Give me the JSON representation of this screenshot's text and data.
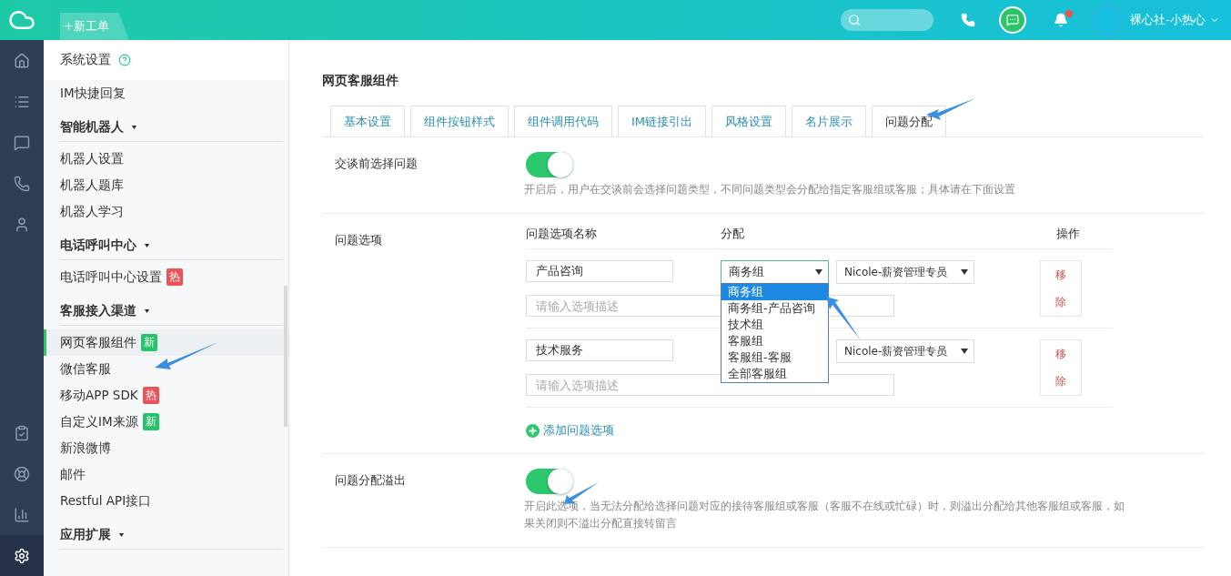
{
  "topbar": {
    "new_ticket": "+新工单",
    "user": "裸心社-小热心",
    "unread": true
  },
  "rail": [
    {
      "selected": false
    },
    {
      "selected": false
    },
    {
      "selected": false
    },
    {
      "selected": false
    },
    {
      "selected": false
    },
    {
      "selected": false
    },
    {
      "selected": false
    },
    {
      "selected": false
    },
    {
      "selected": true
    }
  ],
  "sidebar": {
    "header": "系统设置",
    "items": [
      {
        "kind": "item",
        "label": "IM快捷回复",
        "selected": false
      },
      {
        "kind": "group",
        "label": "智能机器人"
      },
      {
        "kind": "item",
        "label": "机器人设置",
        "selected": false
      },
      {
        "kind": "item",
        "label": "机器人题库",
        "selected": false
      },
      {
        "kind": "item",
        "label": "机器人学习",
        "selected": false
      },
      {
        "kind": "group",
        "label": "电话呼叫中心"
      },
      {
        "kind": "item",
        "label": "电话呼叫中心设置",
        "selected": false,
        "badge": {
          "text": "热",
          "color": "#e9545a"
        }
      },
      {
        "kind": "group",
        "label": "客服接入渠道"
      },
      {
        "kind": "item",
        "label": "网页客服组件",
        "selected": true,
        "badge": {
          "text": "新",
          "color": "#27c26c"
        }
      },
      {
        "kind": "item",
        "label": "微信客服",
        "selected": false
      },
      {
        "kind": "item",
        "label": "移动APP SDK",
        "selected": false,
        "badge": {
          "text": "热",
          "color": "#e9545a"
        }
      },
      {
        "kind": "item",
        "label": "自定义IM来源",
        "selected": false,
        "badge": {
          "text": "新",
          "color": "#27c26c"
        }
      },
      {
        "kind": "item",
        "label": "新浪微博",
        "selected": false
      },
      {
        "kind": "item",
        "label": "邮件",
        "selected": false
      },
      {
        "kind": "item",
        "label": "Restful API接口",
        "selected": false
      },
      {
        "kind": "group",
        "label": "应用扩展"
      }
    ]
  },
  "page_title": "网页客服组件",
  "tabs": [
    {
      "label": "基本设置",
      "selected": false
    },
    {
      "label": "组件按钮样式",
      "selected": false
    },
    {
      "label": "组件调用代码",
      "selected": false
    },
    {
      "label": "IM链接引出",
      "selected": false
    },
    {
      "label": "风格设置",
      "selected": false
    },
    {
      "label": "名片展示",
      "selected": false
    },
    {
      "label": "问题分配",
      "selected": true
    }
  ],
  "pre_chat": {
    "label": "交谈前选择问题",
    "on": true,
    "description": "开启后，用户在交谈前会选择问题类型，不同问题类型会分配给指定客服组或客服；具体请在下面设置"
  },
  "options": {
    "label": "问题选项",
    "columns": [
      "问题选项名称",
      "分配",
      "操作"
    ],
    "rows": [
      {
        "name": "产品咨询",
        "description_placeholder": "请输入选项描述",
        "group": {
          "value": "商务组",
          "open": true,
          "options": [
            {
              "label": "商务组",
              "selected": true
            },
            {
              "label": "商务组-产品咨询",
              "selected": false
            },
            {
              "label": "技术组",
              "selected": false
            },
            {
              "label": "客服组",
              "selected": false
            },
            {
              "label": "客服组-客服",
              "selected": false
            },
            {
              "label": "全部客服组",
              "selected": false
            }
          ]
        },
        "agent": "Nicole-薪资管理专员",
        "remove": "移除"
      },
      {
        "name": "技术服务",
        "description_placeholder": "请输入选项描述",
        "agent": "Nicole-薪资管理专员",
        "remove": "移除"
      }
    ],
    "add": "添加问题选项"
  },
  "overflow": {
    "label": "问题分配溢出",
    "on": true,
    "description": "开启此选项，当无法分配给选择问题对应的接待客服组或客服（客服不在线或忙碌）时，则溢出分配给其他客服组或客服，如果关闭则不溢出分配直接转留言"
  }
}
